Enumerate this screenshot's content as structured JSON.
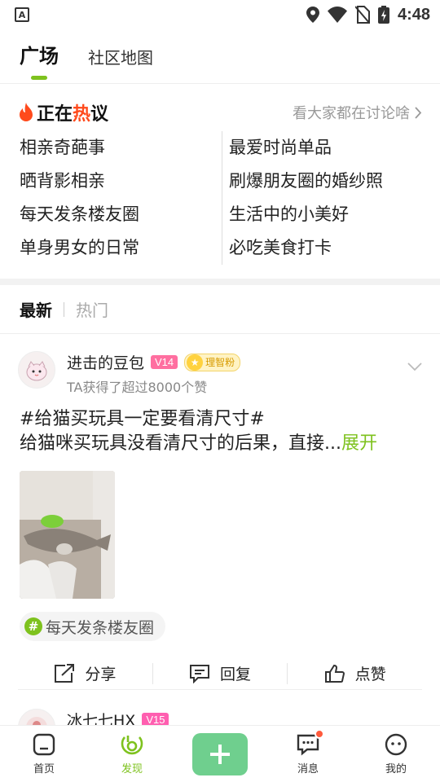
{
  "status_bar": {
    "time": "4:48",
    "left_icon": "A"
  },
  "top_tabs": {
    "active": "广场",
    "other": "社区地图"
  },
  "hot": {
    "title_prefix": "正在",
    "title_hot": "热",
    "title_suffix": "议",
    "more": "看大家都在讨论啥",
    "left": [
      "相亲奇葩事",
      "晒背影相亲",
      "每天发条楼友圈",
      "单身男女的日常"
    ],
    "right": [
      "最爱时尚单品",
      "刷爆朋友圈的婚纱照",
      "生活中的小美好",
      "必吃美食打卡"
    ]
  },
  "feed_tabs": {
    "active": "最新",
    "other": "热门"
  },
  "post": {
    "username": "进击的豆包",
    "level": "V14",
    "fan_badge": "理智粉",
    "subtitle": "TA获得了超过8000个赞",
    "topic_line": "#给猫买玩具一定要看清尺寸#",
    "body": "给猫咪买玩具没看清尺寸的后果，直接...",
    "expand": "展开",
    "tag": "每天发条楼友圈",
    "share": "分享",
    "reply": "回复",
    "like": "点赞"
  },
  "post2": {
    "username": "冰七七HX",
    "level": "V15"
  },
  "bottom_nav": {
    "home": "首页",
    "discover": "发现",
    "messages": "消息",
    "mine": "我的"
  },
  "colors": {
    "accent": "#7ec21e",
    "hot_red": "#ff4a1c",
    "level_pink": "#ff6fa0",
    "plus_green": "#6fcf8e"
  }
}
